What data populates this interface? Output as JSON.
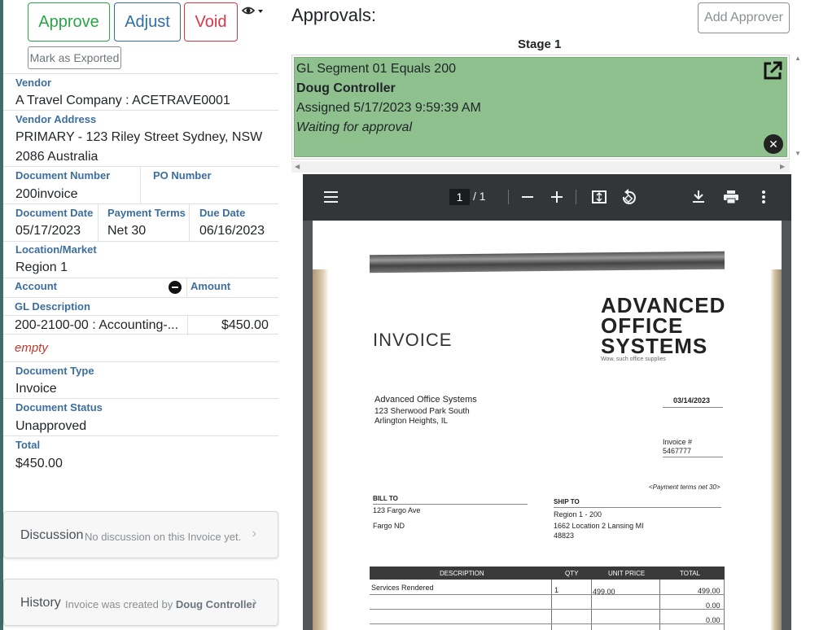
{
  "actions": {
    "approve": "Approve",
    "adjust": "Adjust",
    "void": "Void",
    "mark_exported": "Mark as Exported"
  },
  "details": {
    "vendor_label": "Vendor",
    "vendor": "A Travel Company : ACETRAVE0001",
    "vendor_address_label": "Vendor Address",
    "vendor_address_line1": "PRIMARY - 123 Riley Street Sydney, NSW",
    "vendor_address_line2": "2086 Australia",
    "document_number_label": "Document Number",
    "document_number": "200invoice",
    "po_number_label": "PO Number",
    "document_date_label": "Document Date",
    "document_date": "05/17/2023",
    "payment_terms_label": "Payment Terms",
    "payment_terms": "Net 30",
    "due_date_label": "Due Date",
    "due_date": "06/16/2023",
    "location_label": "Location/Market",
    "location": "Region 1",
    "account_label": "Account",
    "amount_label": "Amount",
    "gl_description_label": "GL Description",
    "gl_line_account": "200-2100-00 : Accounting-...",
    "gl_line_amount": "$450.00",
    "empty_text": "empty",
    "document_type_label": "Document Type",
    "document_type": "Invoice",
    "document_status_label": "Document Status",
    "document_status": "Unapproved",
    "total_label": "Total",
    "total": "$450.00"
  },
  "discussion": {
    "title": "Discussion",
    "subtitle": "No discussion on this Invoice yet."
  },
  "history": {
    "title": "History",
    "subtitle_prefix": "Invoice was created by",
    "subtitle_user": "Doug Controller"
  },
  "approvals": {
    "title": "Approvals:",
    "add_button": "Add Approver",
    "stage_label": "Stage 1",
    "rule": "GL Segment 01 Equals 200",
    "approver": "Doug Controller",
    "assigned": "Assigned 5/17/2023 9:59:39 AM",
    "status": "Waiting for approval"
  },
  "pdf_viewer": {
    "current_page": "1",
    "page_count": "/  1"
  },
  "document_preview": {
    "heading": "INVOICE",
    "logo_line1": "ADVANCED",
    "logo_line2": "OFFICE",
    "logo_line3": "SYSTEMS",
    "tagline": "Wow, such office supplies",
    "company": "Advanced Office Systems",
    "street": "123 Sherwood Park South",
    "city": "Arlington Heights, IL",
    "date": "03/14/2023",
    "invoice_no_label": "Invoice #",
    "invoice_no": "5467777",
    "payment_note": "<Payment terms net 30>",
    "bill_to_label": "BILL TO",
    "bill_to_line1": "123 Fargo Ave",
    "bill_to_line2": "Fargo ND",
    "ship_to_label": "SHIP TO",
    "ship_to_line1": "Region 1 - 200",
    "ship_to_line2": "1662 Location 2 Lansing MI",
    "ship_to_line3": "48823",
    "col_description": "DESCRIPTION",
    "col_qty": "QTY",
    "col_unit_price": "UNIT PRICE",
    "col_total": "TOTAL",
    "line_description": "Services Rendered",
    "line_qty": "1",
    "line_unit_price": "499.00",
    "line_total": "499.00",
    "zero_a": "0.00",
    "zero_b": "0.00"
  }
}
